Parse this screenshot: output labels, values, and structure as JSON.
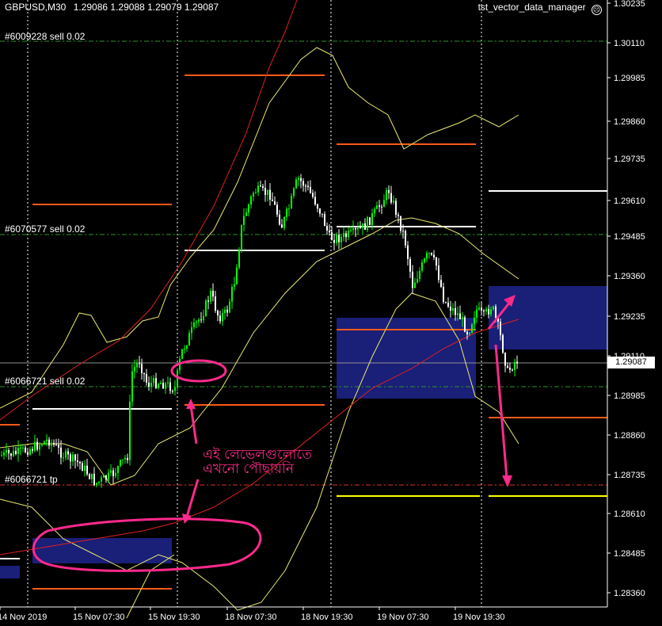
{
  "header": {
    "symbol_timeframe": "GBPUSD,M30",
    "ohlc": "1.29086 1.29088 1.29079 1.29087"
  },
  "expert": {
    "name": "tst_vector_data_manager",
    "icon": "frown-face-icon"
  },
  "price_axis": {
    "ticks": [
      "1.30235",
      "1.30110",
      "1.29985",
      "1.29860",
      "1.29735",
      "1.29610",
      "1.29485",
      "1.29360",
      "1.29235",
      "1.29110",
      "1.28985",
      "1.28860",
      "1.28735",
      "1.28610",
      "1.28485",
      "1.28360"
    ],
    "current_price": "1.29087"
  },
  "time_axis": {
    "ticks": [
      "14 Nov 2019",
      "15 Nov 07:30",
      "15 Nov 19:30",
      "18 Nov 07:30",
      "18 Nov 19:30",
      "19 Nov 07:30",
      "19 Nov 19:30"
    ]
  },
  "orders": [
    {
      "label": "#6009228 sell 0.02"
    },
    {
      "label": "#6070577 sell 0.02"
    },
    {
      "label": "#6066721 sell 0.02"
    },
    {
      "label": "#6066721 tp"
    }
  ],
  "annotation": {
    "line1": "এই লেভেলগুলোতে",
    "line2": "এখনো পৌছায়নি"
  },
  "colors": {
    "background": "#000000",
    "bull_candle": "#00ff00",
    "bear_candle": "#ffffff",
    "order_line": "#2a9a2a",
    "tp_line": "#e03030",
    "annotation": "#ff2a8c",
    "zone": "#1a1f78",
    "level_orange": "#ff5a1a",
    "level_white": "#ffffff",
    "level_yellow": "#ffff00",
    "band": "#e8e870",
    "ma": "#e02020"
  }
}
